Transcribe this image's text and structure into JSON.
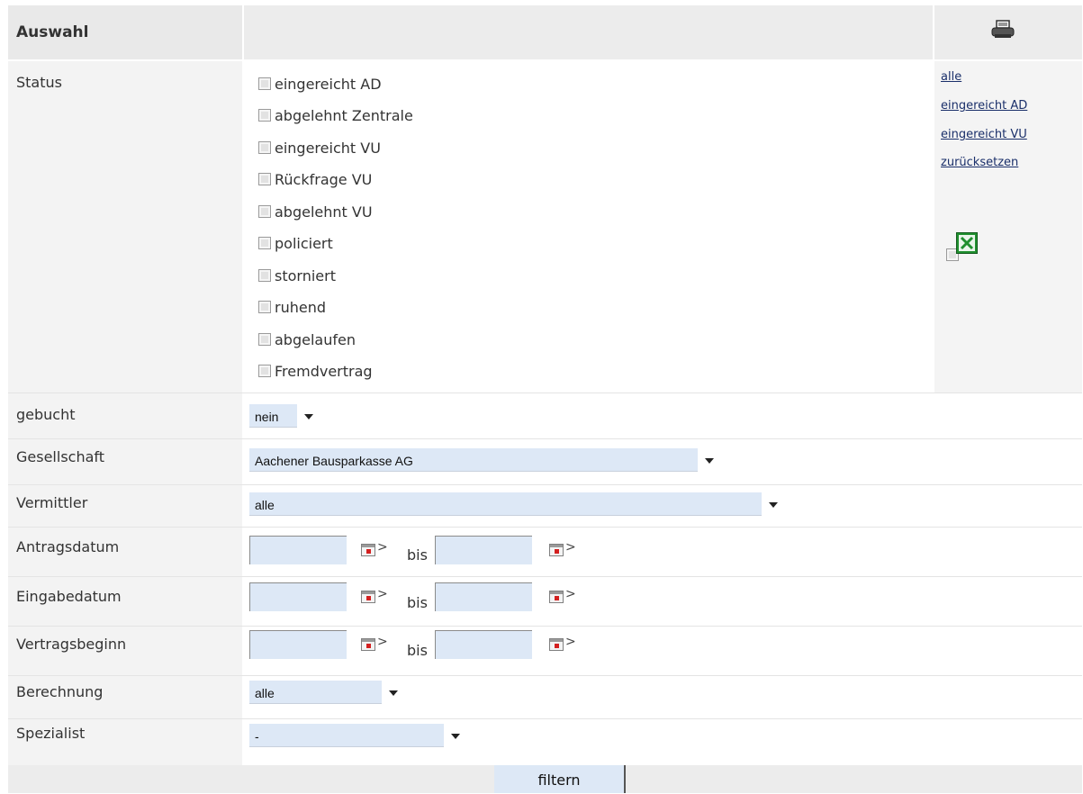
{
  "header": {
    "title": "Auswahl",
    "print_icon": "printer-icon"
  },
  "status": {
    "label": "Status",
    "options": [
      "eingereicht AD",
      "abgelehnt Zentrale",
      "eingereicht VU",
      "Rückfrage VU",
      "abgelehnt VU",
      "policiert",
      "storniert",
      "ruhend",
      "abgelaufen",
      "Fremdvertrag"
    ],
    "links": [
      "alle",
      "eingereicht AD",
      "eingereicht VU",
      "zurücksetzen"
    ],
    "export_icon": "excel-icon"
  },
  "fields": {
    "gebucht": {
      "label": "gebucht",
      "value": "nein"
    },
    "gesellschaft": {
      "label": "Gesellschaft",
      "value": "Aachener Bausparkasse AG"
    },
    "vermittler": {
      "label": "Vermittler",
      "value": "alle"
    },
    "antragsdatum": {
      "label": "Antragsdatum",
      "sep": "bis",
      "from": "",
      "to": ""
    },
    "eingabedatum": {
      "label": "Eingabedatum",
      "sep": "bis",
      "from": "",
      "to": ""
    },
    "vertragsbeginn": {
      "label": "Vertragsbeginn",
      "sep": "bis",
      "from": "",
      "to": ""
    },
    "berechnung": {
      "label": "Berechnung",
      "value": "alle"
    },
    "spezialist": {
      "label": "Spezialist",
      "value": "-"
    }
  },
  "footer": {
    "submit_label": "filtern"
  },
  "colors": {
    "label_bg": "#f3f3f3",
    "header_bg": "#ececec",
    "input_bg": "#dde8f6",
    "link": "#1a2f6a"
  }
}
